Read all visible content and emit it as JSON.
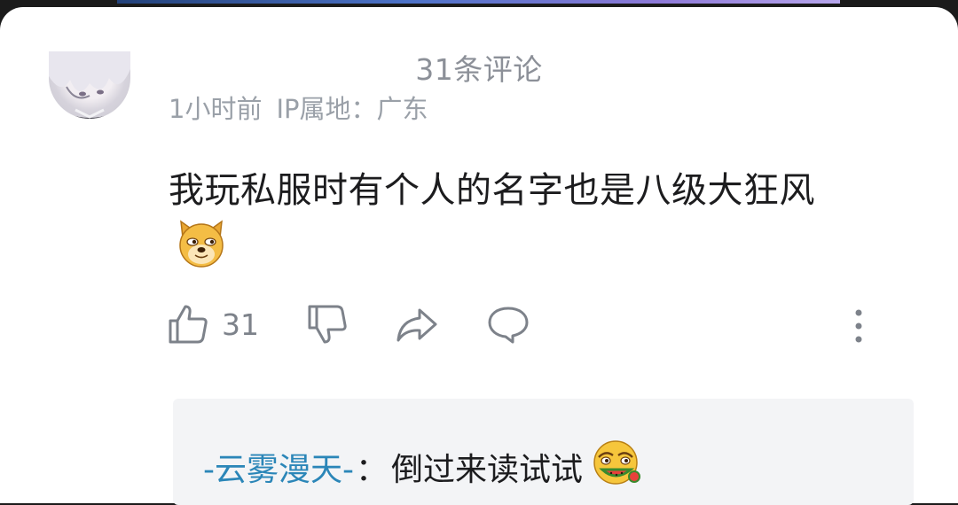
{
  "header": {
    "title": "31条评论"
  },
  "comment": {
    "avatar_icon": "anime-avatar",
    "time": "1小时前",
    "ip_location": "IP属地：广东",
    "text": "我玩私服时有个人的名字也是八级大狂风",
    "emoji": "doge-emoji",
    "likes": "31",
    "actions": [
      "thumbs-up-icon",
      "thumbs-down-icon",
      "share-arrow-icon",
      "comment-bubble-icon",
      "more-vertical-icon"
    ]
  },
  "reply": {
    "username": "-云雾漫天-",
    "separator": "：",
    "text": "倒过来读试试",
    "emoji": "watermelon-eating-emoji"
  },
  "colors": {
    "background": "#ffffff",
    "meta_text": "#9aa0a8",
    "body_text": "#1c1c1e",
    "reply_username": "#2b86b8",
    "reply_background": "#f3f4f6",
    "top_strip_accent": "#4d73c8"
  }
}
